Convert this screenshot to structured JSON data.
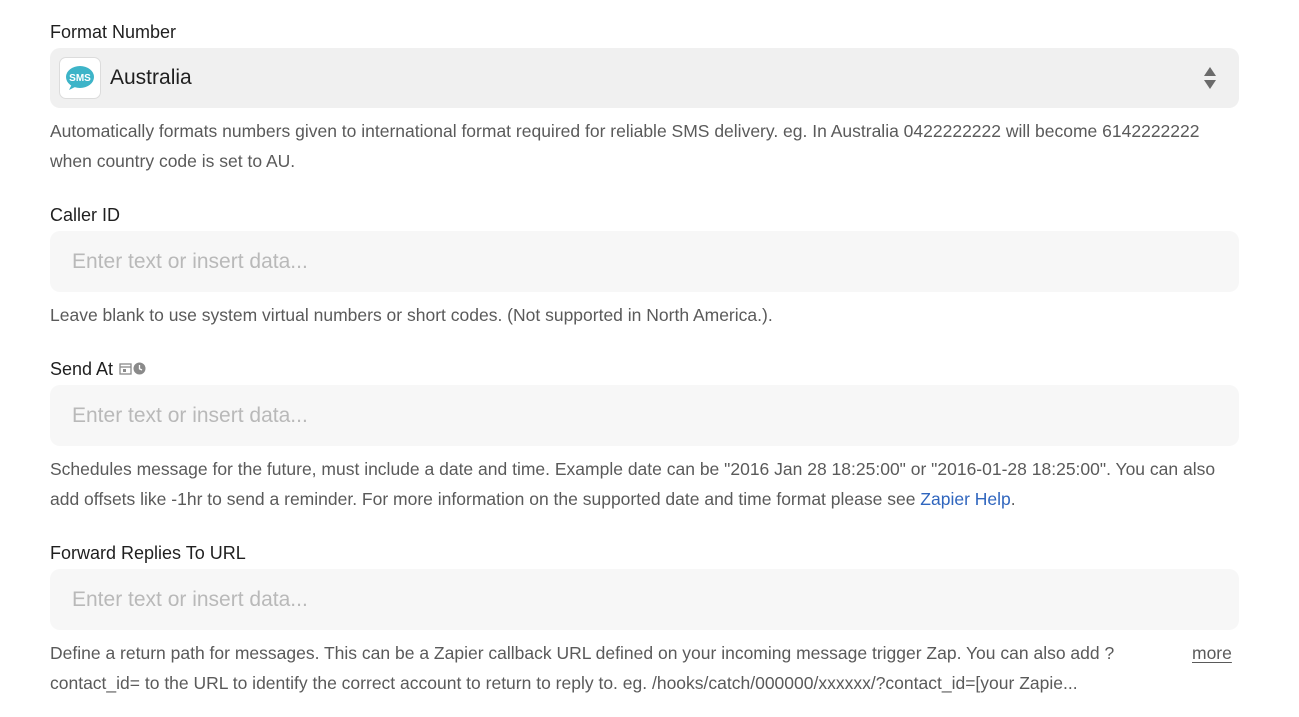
{
  "format_number": {
    "label": "Format Number",
    "app_icon": "sms-bubble-icon",
    "app_icon_text": "SMS",
    "value": "Australia",
    "help": "Automatically formats numbers given to international format required for reliable SMS delivery. eg. In Australia 0422222222 will become 6142222222 when country code is set to AU."
  },
  "caller_id": {
    "label": "Caller ID",
    "placeholder": "Enter text or insert data...",
    "help": "Leave blank to use system virtual numbers or short codes. (Not supported in North America.)."
  },
  "send_at": {
    "label": "Send At",
    "icons": [
      "calendar-icon",
      "clock-icon"
    ],
    "placeholder": "Enter text or insert data...",
    "help": "Schedules message for the future, must include a date and time. Example date can be \"2016 Jan 28 18:25:00\" or \"2016-01-28 18:25:00\". You can also add offsets like -1hr to send a reminder. For more information on the supported date and time format please see ",
    "help_link": "Zapier Help",
    "help_end": "."
  },
  "forward_replies": {
    "label": "Forward Replies To URL",
    "placeholder": "Enter text or insert data...",
    "help": "Define a return path for messages. This can be a Zapier callback URL defined on your incoming message trigger Zap. You can also add ?contact_id= to the URL to identify the correct account to return to reply to. eg. /hooks/catch/000000/xxxxxx/?contact_id=[your Zapie...",
    "more_label": "more"
  },
  "colors": {
    "link": "#3066be",
    "icon_accent": "#3db4c8"
  }
}
